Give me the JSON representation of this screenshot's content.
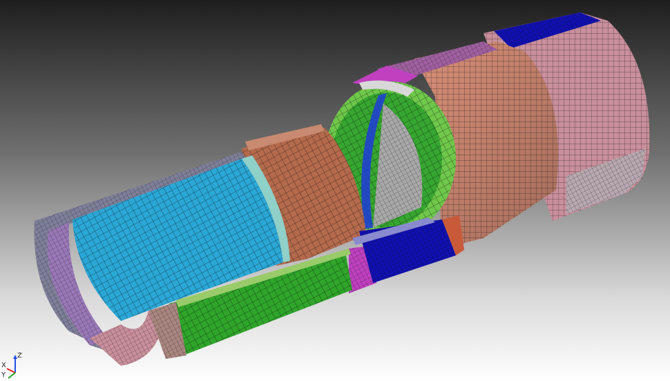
{
  "triad": {
    "x_label": "X",
    "y_label": "Y",
    "z_label": "Z",
    "colors": {
      "x": "#e02020",
      "y": "#20a020",
      "z": "#2050e0"
    }
  },
  "palette": {
    "background_top": "#1e1e1e",
    "background_bottom": "#ffffff",
    "inner_liner": "#2aa7d6",
    "copper_shell": "#b46a4c",
    "green_band": "#2fa52a",
    "blue_band": "#1010b0",
    "magenta_band": "#c040c0",
    "salmon_drum": "#d98f78",
    "pink_drum": "#c98f9c",
    "pipe_end": "#9a5a60",
    "mesh_line": "#101010"
  }
}
